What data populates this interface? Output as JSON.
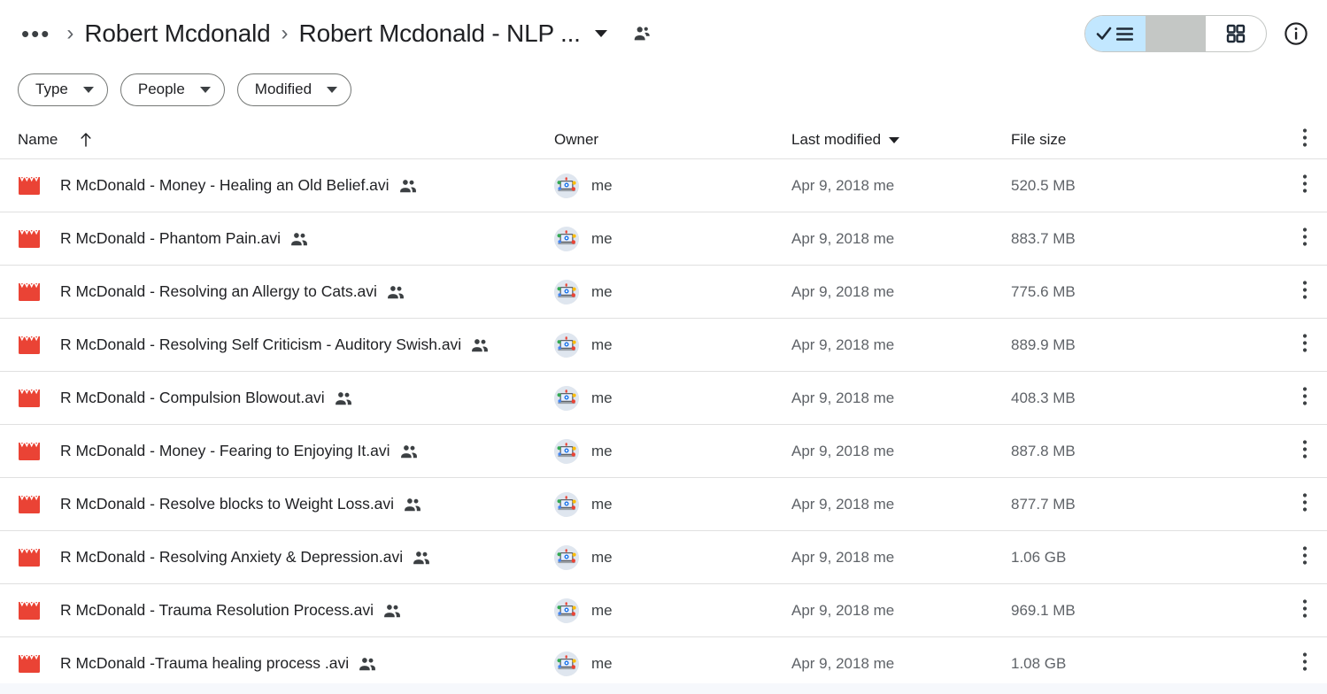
{
  "breadcrumb": {
    "ellipsis": "•••",
    "separator": "›",
    "parent": "Robert Mcdonald",
    "current": "Robert Mcdonald - NLP ...",
    "dropdown_icon": "caret-down-icon",
    "share_icon": "shared-people-icon"
  },
  "topbar": {
    "list_view_icon": "list-view-check-icon",
    "grid_view_icon": "grid-view-icon",
    "info_icon": "info-circle-icon",
    "active_view": "list",
    "active_view_bg": "#c2e7ff"
  },
  "filters": [
    {
      "label": "Type",
      "icon": "chevron-down-icon"
    },
    {
      "label": "People",
      "icon": "chevron-down-icon"
    },
    {
      "label": "Modified",
      "icon": "chevron-down-icon"
    }
  ],
  "columns": {
    "name": "Name",
    "name_sort_icon": "arrow-up-icon",
    "owner": "Owner",
    "modified": "Last modified",
    "modified_sort_icon": "caret-down-icon",
    "size": "File size",
    "overflow_icon": "more-vertical-icon"
  },
  "files": [
    {
      "name": "R McDonald -  Money - Healing an Old Belief.avi",
      "icon": "video-clapperboard-icon",
      "shared": true,
      "owner": "me",
      "modified": "Apr 9, 2018 me",
      "size": "520.5 MB"
    },
    {
      "name": "R McDonald -  Phantom Pain.avi",
      "icon": "video-clapperboard-icon",
      "shared": true,
      "owner": "me",
      "modified": "Apr 9, 2018 me",
      "size": "883.7 MB"
    },
    {
      "name": "R McDonald -  Resolving an Allergy to Cats.avi",
      "icon": "video-clapperboard-icon",
      "shared": true,
      "owner": "me",
      "modified": "Apr 9, 2018 me",
      "size": "775.6 MB"
    },
    {
      "name": "R McDonald -  Resolving Self Criticism - Auditory Swish.avi",
      "icon": "video-clapperboard-icon",
      "shared": true,
      "owner": "me",
      "modified": "Apr 9, 2018 me",
      "size": "889.9 MB"
    },
    {
      "name": "R McDonald - Compulsion Blowout.avi",
      "icon": "video-clapperboard-icon",
      "shared": true,
      "owner": "me",
      "modified": "Apr 9, 2018 me",
      "size": "408.3 MB"
    },
    {
      "name": "R McDonald - Money - Fearing to Enjoying It.avi",
      "icon": "video-clapperboard-icon",
      "shared": true,
      "owner": "me",
      "modified": "Apr 9, 2018 me",
      "size": "887.8 MB"
    },
    {
      "name": "R McDonald - Resolve blocks to Weight Loss.avi",
      "icon": "video-clapperboard-icon",
      "shared": true,
      "owner": "me",
      "modified": "Apr 9, 2018 me",
      "size": "877.7 MB"
    },
    {
      "name": "R McDonald - Resolving Anxiety & Depression.avi",
      "icon": "video-clapperboard-icon",
      "shared": true,
      "owner": "me",
      "modified": "Apr 9, 2018 me",
      "size": "1.06 GB"
    },
    {
      "name": "R McDonald - Trauma Resolution Process.avi",
      "icon": "video-clapperboard-icon",
      "shared": true,
      "owner": "me",
      "modified": "Apr 9, 2018 me",
      "size": "969.1 MB"
    },
    {
      "name": "R McDonald -Trauma healing process .avi",
      "icon": "video-clapperboard-icon",
      "shared": true,
      "owner": "me",
      "modified": "Apr 9, 2018 me",
      "size": "1.08 GB"
    }
  ],
  "colors": {
    "video_icon_red": "#ea4335",
    "accent_blue": "#c2e7ff",
    "divider": "#e0e0e0",
    "secondary_text": "#5f6368"
  }
}
